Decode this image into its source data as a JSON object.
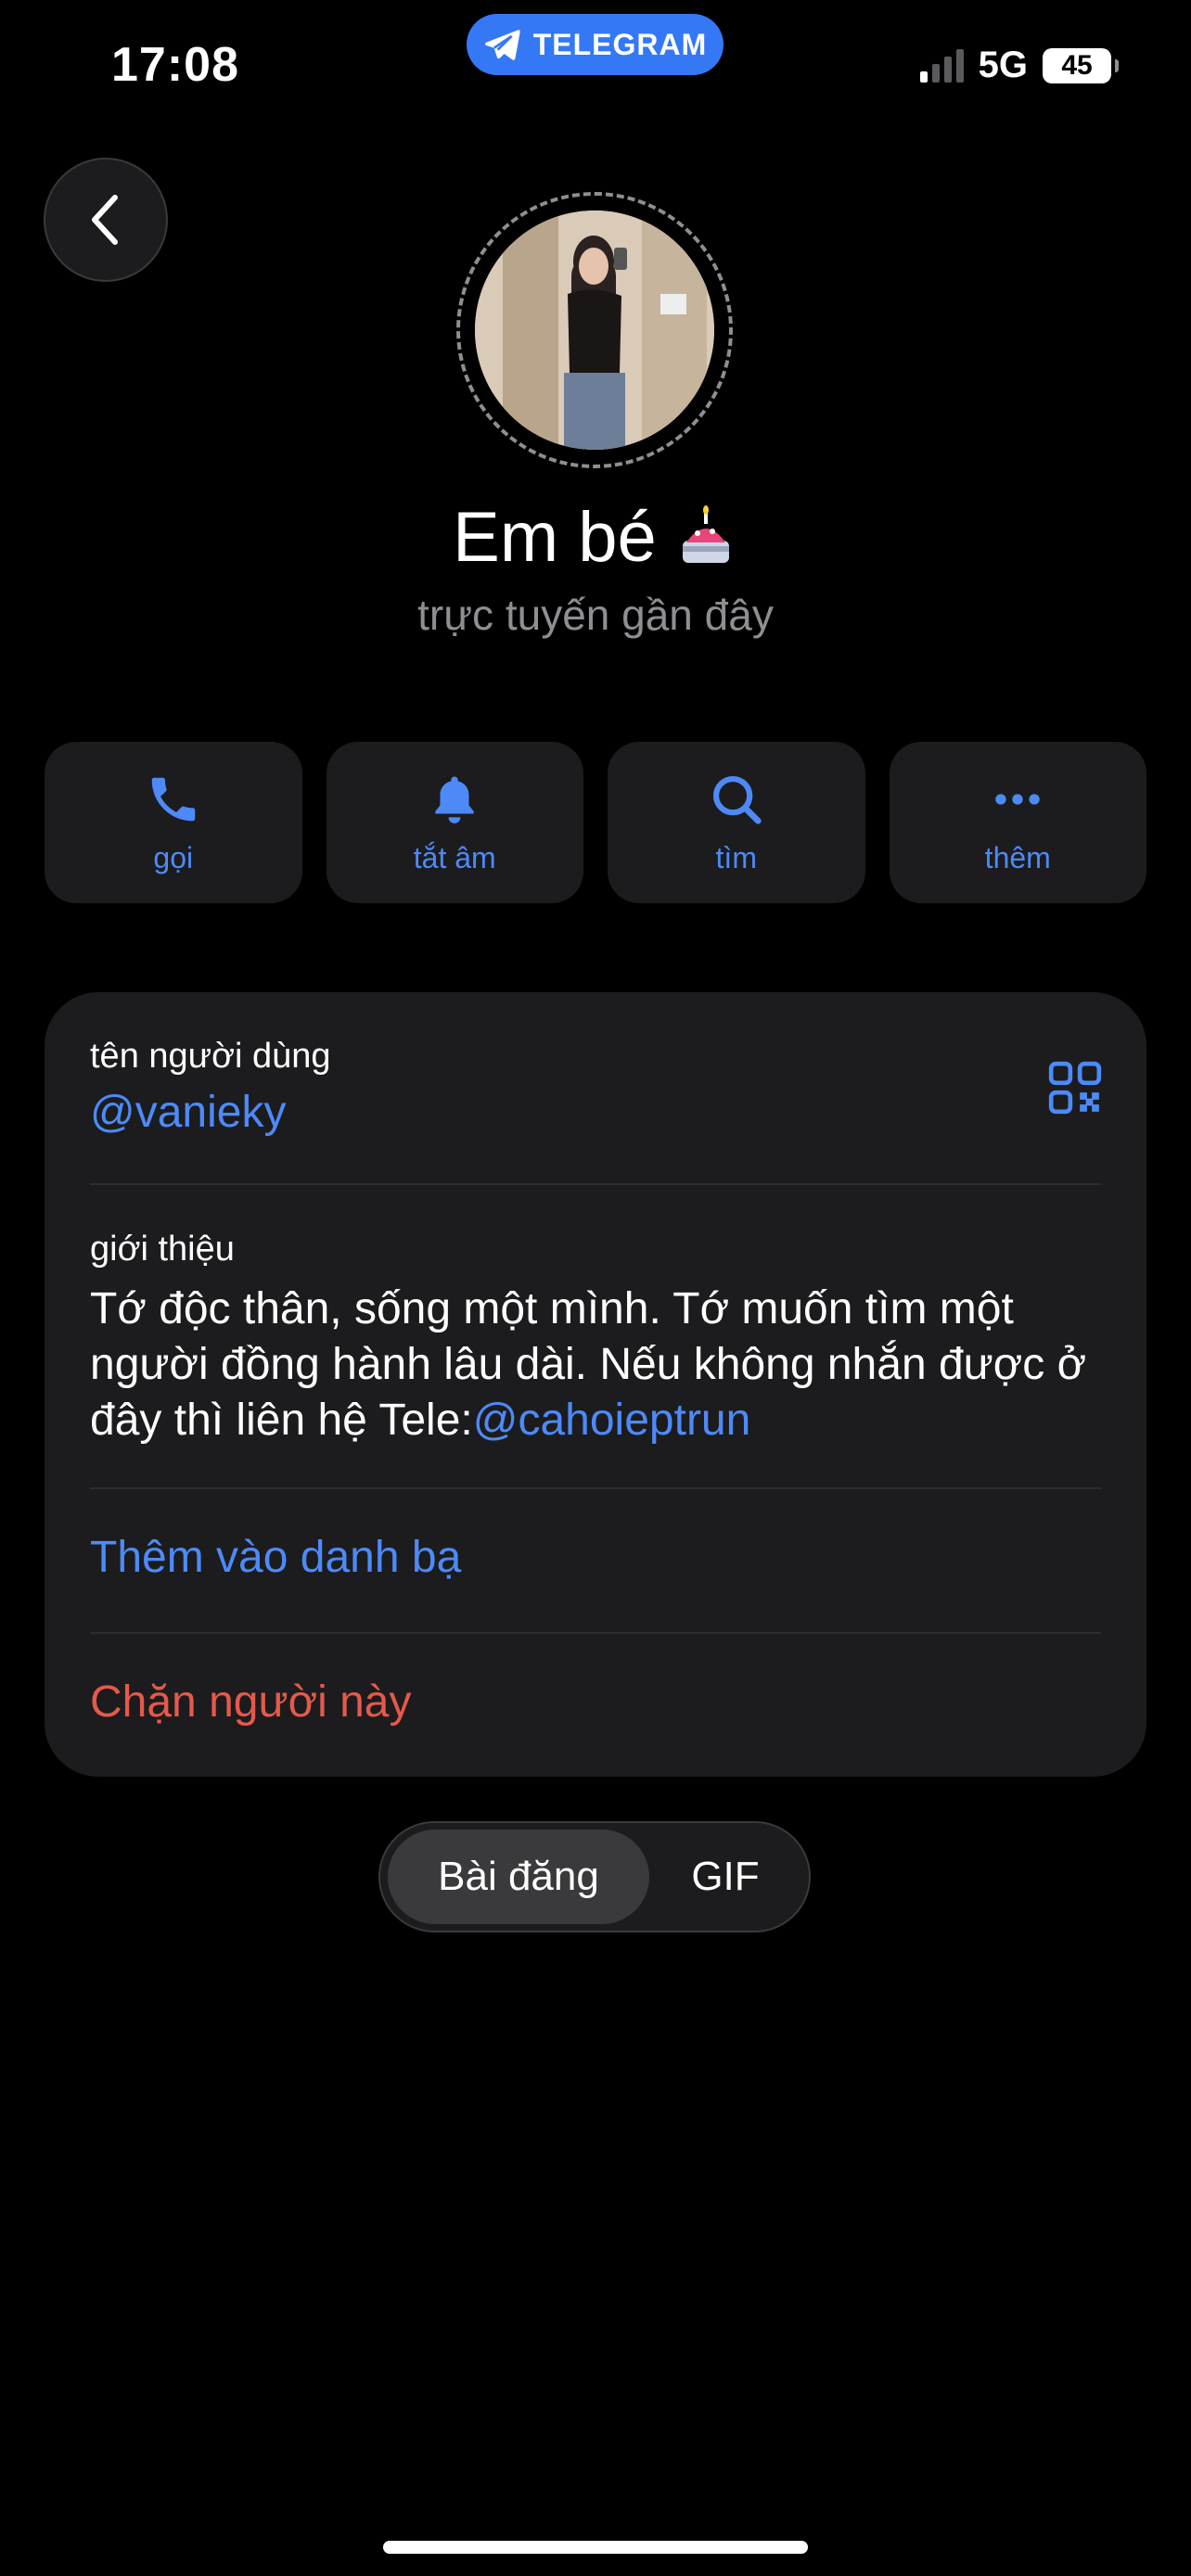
{
  "status_bar": {
    "time": "17:08",
    "app_pill": "TELEGRAM",
    "network": "5G",
    "battery": "45"
  },
  "profile": {
    "name": "Em bé",
    "name_emoji": "🎂",
    "status": "trực tuyến gần đây"
  },
  "actions": {
    "call": "gọi",
    "mute": "tắt âm",
    "search": "tìm",
    "more": "thêm"
  },
  "info": {
    "username_label": "tên người dùng",
    "username": "@vanieky",
    "bio_label": "giới thiệu",
    "bio_text": "Tớ độc thân, sống một mình. Tớ muốn tìm một người đồng hành lâu dài. Nếu không nhắn được ở đây thì liên hệ Tele:",
    "bio_link": "@cahoieptrun",
    "add_contact": "Thêm vào danh bạ",
    "block_user": "Chặn người này"
  },
  "tabs": {
    "posts": "Bài đăng",
    "gif": "GIF"
  },
  "colors": {
    "accent": "#4d8af8",
    "danger": "#e5594b",
    "card_bg": "#1c1c1e",
    "secondary_text": "#8e8e93"
  }
}
